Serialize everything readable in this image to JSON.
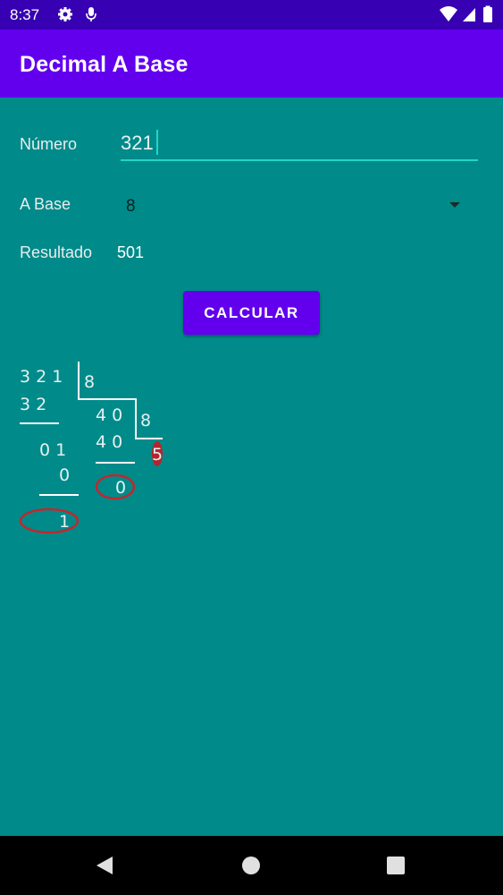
{
  "status_bar": {
    "time": "8:37",
    "icons": [
      "settings-gear-icon",
      "microphone-icon",
      "wifi-icon",
      "signal-icon",
      "battery-icon"
    ]
  },
  "app_bar": {
    "title": "Decimal A Base"
  },
  "form": {
    "numero_label": "Número",
    "numero_value": "321",
    "base_label": "A Base",
    "base_selected": "8",
    "resultado_label": "Resultado",
    "resultado_value": "501",
    "calcular_label": "CALCULAR"
  },
  "division": {
    "step1_dividend": "3 2 1",
    "step1_divisor": "8",
    "step1_subtract": "3 2",
    "step1_diff": "0 1",
    "step1_subtract2": "0",
    "step1_remainder": "1",
    "step2_dividend": "4 0",
    "step2_divisor": "8",
    "step2_subtract": "4 0",
    "step2_remainder": "0",
    "step3_quotient": "5"
  },
  "colors": {
    "status_bar": "#3700b3",
    "app_bar": "#6200ee",
    "background": "#008a8a",
    "accent": "#21d7c4",
    "highlight_circle": "#c0282f"
  },
  "nav_bar": {
    "icons": [
      "back-icon",
      "home-icon",
      "recents-icon"
    ]
  }
}
